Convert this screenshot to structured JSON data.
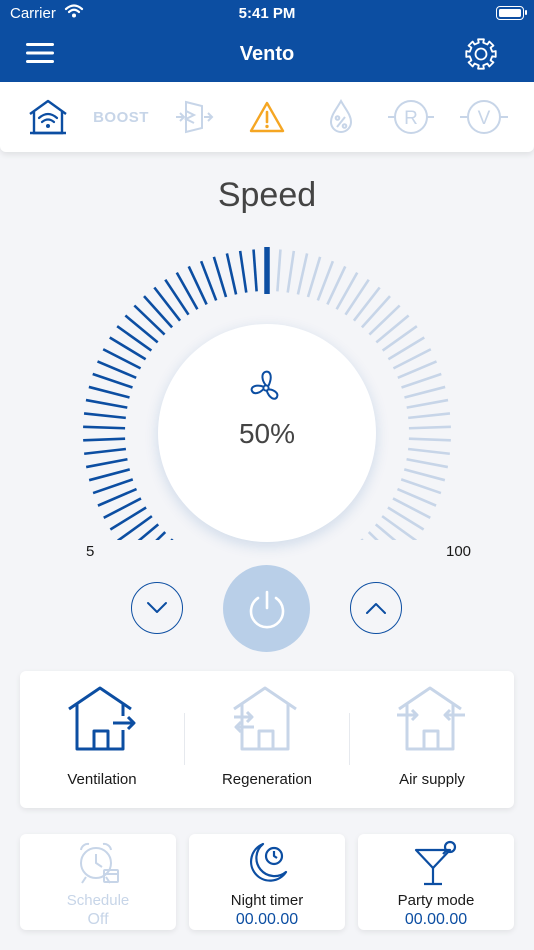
{
  "status_bar": {
    "carrier": "Carrier",
    "time": "5:41 PM"
  },
  "nav": {
    "title": "Vento",
    "menu_icon": "hamburger-menu-icon",
    "settings_icon": "gear-icon"
  },
  "mode_strip": {
    "items": [
      {
        "icon": "home-wifi-icon",
        "active": true
      },
      {
        "label": "BOOST",
        "active": false
      },
      {
        "icon": "filter-icon",
        "active": false
      },
      {
        "icon": "warning-icon",
        "active": true,
        "color": "#f5a623"
      },
      {
        "icon": "humidity-icon",
        "active": false
      },
      {
        "label": "R",
        "active": false
      },
      {
        "label": "V",
        "active": false
      }
    ]
  },
  "speed": {
    "title": "Speed",
    "value_label": "50%",
    "level": 0.5,
    "min_label": "5",
    "max_label": "100"
  },
  "controls": {
    "down_icon": "chevron-down-icon",
    "power_icon": "power-icon",
    "up_icon": "chevron-up-icon"
  },
  "modes": [
    {
      "label": "Ventilation",
      "active": true
    },
    {
      "label": "Regeneration",
      "active": false
    },
    {
      "label": "Air supply",
      "active": false
    }
  ],
  "cards": {
    "schedule": {
      "title": "Schedule",
      "value": "Off",
      "active": false
    },
    "night_timer": {
      "title": "Night timer",
      "value": "00.00.00",
      "active": true
    },
    "party_mode": {
      "title": "Party mode",
      "value": "00.00.00",
      "active": true
    }
  },
  "colors": {
    "primary": "#0c4ea2",
    "inactive": "#c7d5e8",
    "warning": "#f5a623",
    "power_bg": "#b9cfe8"
  }
}
